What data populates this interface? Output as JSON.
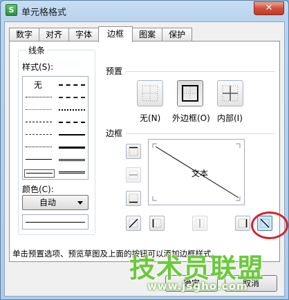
{
  "window": {
    "title": "单元格格式",
    "app_icon_glyph": "S",
    "close_glyph": "✕"
  },
  "tabs": [
    {
      "label": "数字"
    },
    {
      "label": "对齐"
    },
    {
      "label": "字体"
    },
    {
      "label": "边框",
      "active": true
    },
    {
      "label": "图案"
    },
    {
      "label": "保护"
    }
  ],
  "line": {
    "group_label": "线条",
    "style_label": "样式(S):",
    "none_label": "无",
    "color_label": "颜色(C):",
    "color_value": "自动"
  },
  "presets": {
    "group_label": "预置",
    "none_label": "无(N)",
    "outline_label": "外边框(O)",
    "inside_label": "内部(I)"
  },
  "border": {
    "group_label": "边框",
    "preview_text": "文本"
  },
  "hint": "单击预置选项、预览草图及上面的按钮可以添加边框样式。",
  "footer": {
    "ok_label": "确定",
    "cancel_label": "取消"
  },
  "watermark": {
    "title": "技术员联盟",
    "url": "www.jsgho.com"
  },
  "colors": {
    "accent_ring": "#d3232a",
    "watermark_green": "#6bc93a",
    "titlebar": "#b9d4ee"
  }
}
